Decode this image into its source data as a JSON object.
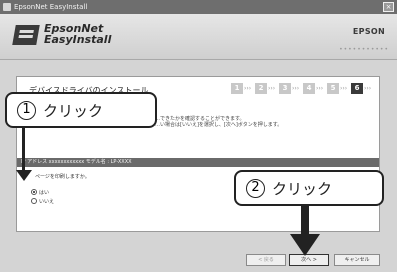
{
  "window": {
    "title": "EpsonNet EasyInstall",
    "close_glyph": "×",
    "app_logo_line1": "EpsonNet",
    "app_logo_line2": "EasyInstall",
    "brand": "EPSON",
    "dots": "•••••••••••"
  },
  "panel": {
    "title": "デバイスドライバのインストール",
    "steps": [
      "1",
      "2",
      "3",
      "4",
      "5",
      "6"
    ],
    "active_step": "6",
    "desc1": "…できたかを確認することができます。",
    "desc2": "…い場合は[いいえ]を選択し、[次へ]ボタンを押します。",
    "printer_bar": "IP アドレス xxxxxxxxxxxx  モデル名 : LP-XXXX",
    "question": "ページを印刷しますか。",
    "options": [
      {
        "label": "はい",
        "checked": true
      },
      {
        "label": "いいえ",
        "checked": false
      }
    ]
  },
  "buttons": {
    "back": "< 戻る",
    "next": "次へ >",
    "cancel": "キャンセル"
  },
  "annotations": {
    "callout1_num": "1",
    "callout1_text": "クリック",
    "callout2_num": "2",
    "callout2_text": "クリック"
  }
}
